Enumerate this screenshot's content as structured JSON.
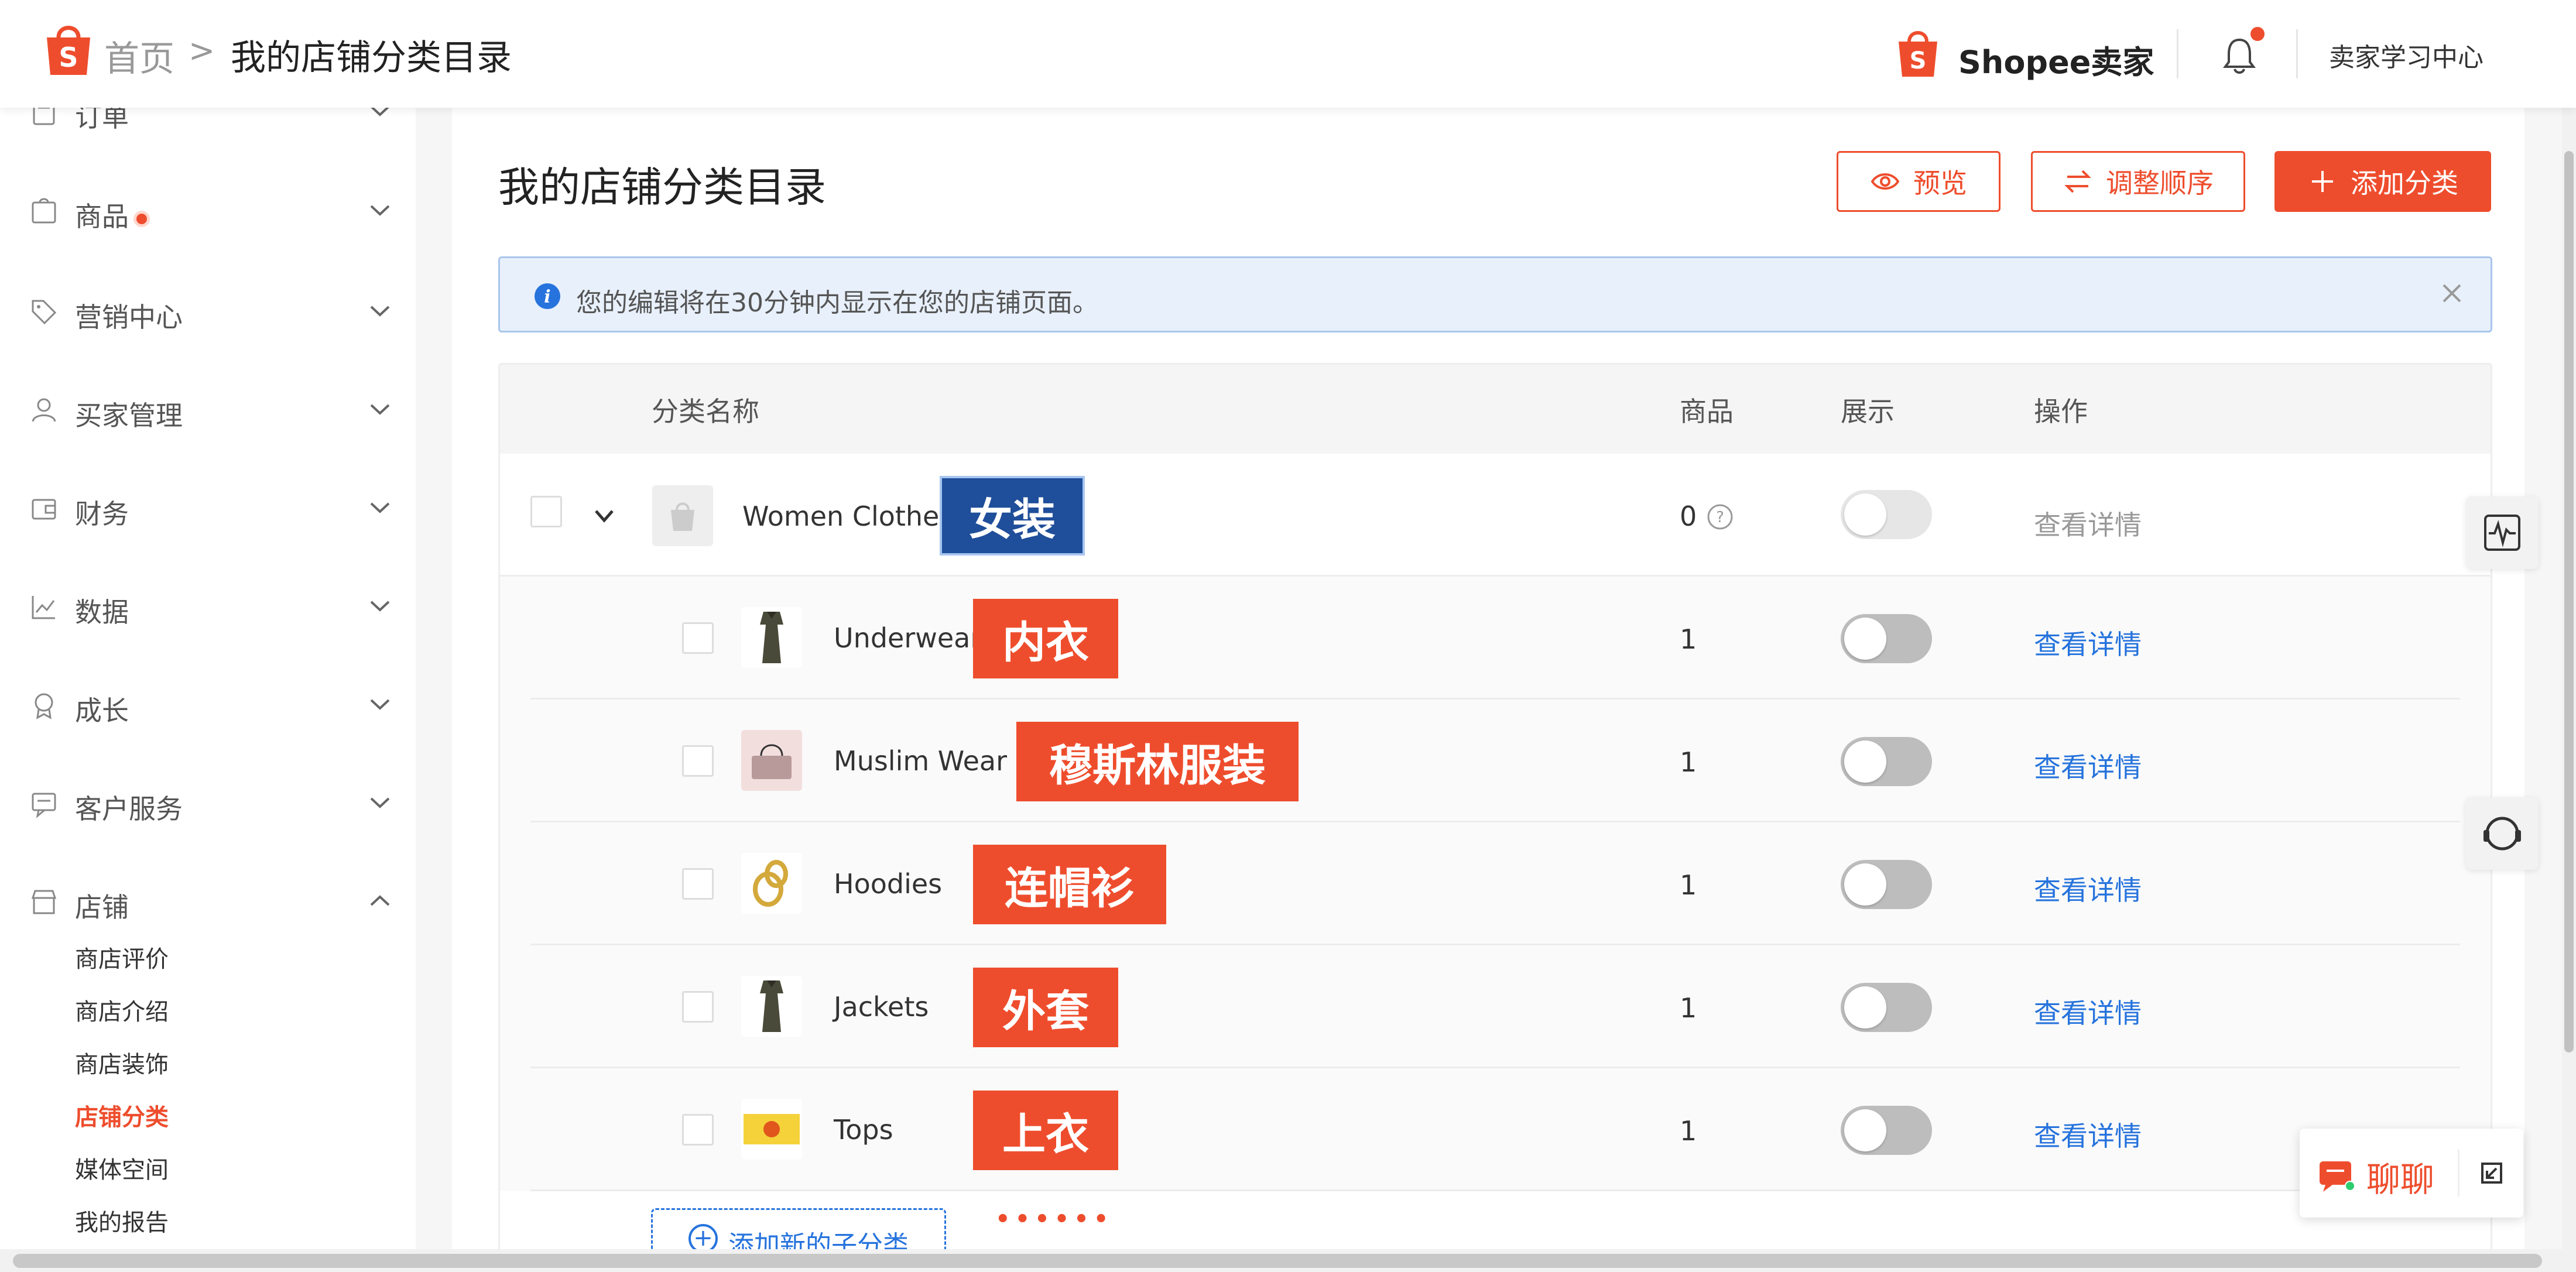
{
  "header": {
    "breadcrumb_home": "首页",
    "breadcrumb_sep": ">",
    "breadcrumb_current": "我的店铺分类目录",
    "brand": "Shopee卖家",
    "learning_center": "卖家学习中心"
  },
  "sidebar": {
    "items": [
      {
        "label": "订单",
        "icon": "order-icon"
      },
      {
        "label": "商品",
        "icon": "product-icon"
      },
      {
        "label": "营销中心",
        "icon": "tag-icon"
      },
      {
        "label": "买家管理",
        "icon": "user-icon"
      },
      {
        "label": "财务",
        "icon": "wallet-icon"
      },
      {
        "label": "数据",
        "icon": "chart-icon"
      },
      {
        "label": "成长",
        "icon": "badge-icon"
      },
      {
        "label": "客户服务",
        "icon": "chat-icon"
      },
      {
        "label": "店铺",
        "icon": "shop-icon"
      }
    ],
    "shop_sub": [
      "商店评价",
      "商店介绍",
      "商店装饰",
      "店铺分类",
      "媒体空间",
      "我的报告"
    ]
  },
  "main": {
    "title": "我的店铺分类目录",
    "btn_preview": "预览",
    "btn_reorder": "调整顺序",
    "btn_add": "添加分类",
    "info_text": "您的编辑将在30分钟内显示在您的店铺页面。",
    "columns": {
      "name": "分类名称",
      "products": "商品",
      "display": "展示",
      "action": "操作"
    },
    "parent": {
      "name": "Women Clothes",
      "tag": "女装",
      "count": "0",
      "action": "查看详情"
    },
    "children": [
      {
        "name": "Underwear",
        "tag": "内衣",
        "count": "1",
        "action": "查看详情"
      },
      {
        "name": "Muslim Wear",
        "tag": "穆斯林服装",
        "count": "1",
        "action": "查看详情"
      },
      {
        "name": "Hoodies",
        "tag": "连帽衫",
        "count": "1",
        "action": "查看详情"
      },
      {
        "name": "Jackets",
        "tag": "外套",
        "count": "1",
        "action": "查看详情"
      },
      {
        "name": "Tops",
        "tag": "上衣",
        "count": "1",
        "action": "查看详情"
      }
    ],
    "add_sub": "添加新的子分类",
    "dots": "••••••"
  },
  "chat": {
    "label": "聊聊"
  },
  "colors": {
    "accent": "#ee4d2d",
    "link": "#2673dd",
    "info_bg": "#e8f0fb"
  }
}
